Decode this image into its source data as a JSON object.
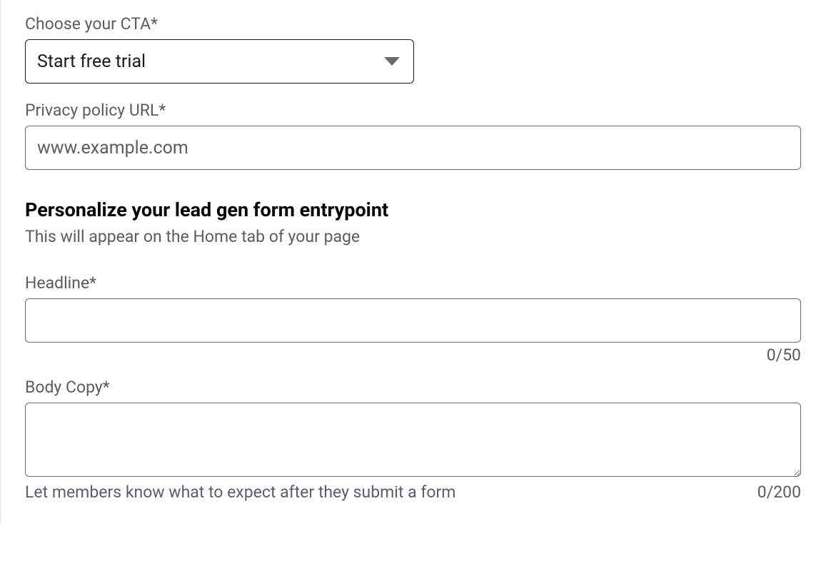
{
  "cta": {
    "label": "Choose your CTA*",
    "value": "Start free trial"
  },
  "privacy": {
    "label": "Privacy policy URL*",
    "value": "www.example.com"
  },
  "section": {
    "title": "Personalize your lead gen form entrypoint",
    "subtitle": "This will appear on the Home tab of your page"
  },
  "headline": {
    "label": "Headline*",
    "value": "",
    "counter": "0/50"
  },
  "body": {
    "label": "Body Copy*",
    "value": "",
    "helper": "Let members know what to expect after they submit a form",
    "counter": "0/200"
  }
}
